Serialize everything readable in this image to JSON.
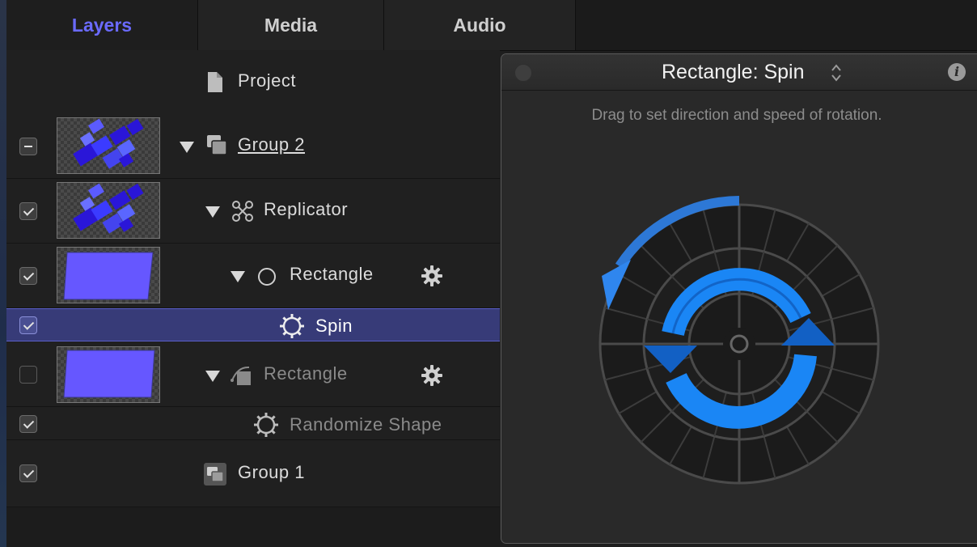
{
  "tabs": [
    {
      "label": "Layers",
      "active": true
    },
    {
      "label": "Media",
      "active": false
    },
    {
      "label": "Audio",
      "active": false
    }
  ],
  "layers": [
    {
      "label": "Project",
      "icon": "project-document-icon"
    },
    {
      "label": "Group 2",
      "icon": "group-icon",
      "checkbox": "mixed",
      "expanded": true,
      "thumbnail": "replicator-squares"
    },
    {
      "label": "Replicator",
      "icon": "replicator-icon",
      "checkbox": "checked",
      "expanded": true,
      "thumbnail": "replicator-squares"
    },
    {
      "label": "Rectangle",
      "icon": "circle-shape-icon",
      "checkbox": "checked",
      "expanded": true,
      "thumbnail": "purple-rectangle"
    },
    {
      "label": "Spin",
      "icon": "behavior-gear-icon",
      "checkbox": "checked",
      "selected": true
    },
    {
      "label": "Rectangle",
      "icon": "shape-icon",
      "checkbox": "unchecked",
      "expanded": true,
      "thumbnail": "purple-rectangle",
      "dimmed": true
    },
    {
      "label": "Randomize Shape",
      "icon": "behavior-gear-icon",
      "checkbox": "checked",
      "dimmed": true
    },
    {
      "label": "Group 1",
      "icon": "group-icon",
      "checkbox": "checked"
    }
  ],
  "hud": {
    "title": "Rectangle: Spin",
    "hint": "Drag to set direction and speed of rotation.",
    "info_glyph": "i"
  },
  "colors": {
    "accent": "#6a6aff",
    "selection": "#373b78",
    "thumbnail_fill": "#6657ff",
    "spin_blue": "#1f8bff"
  }
}
